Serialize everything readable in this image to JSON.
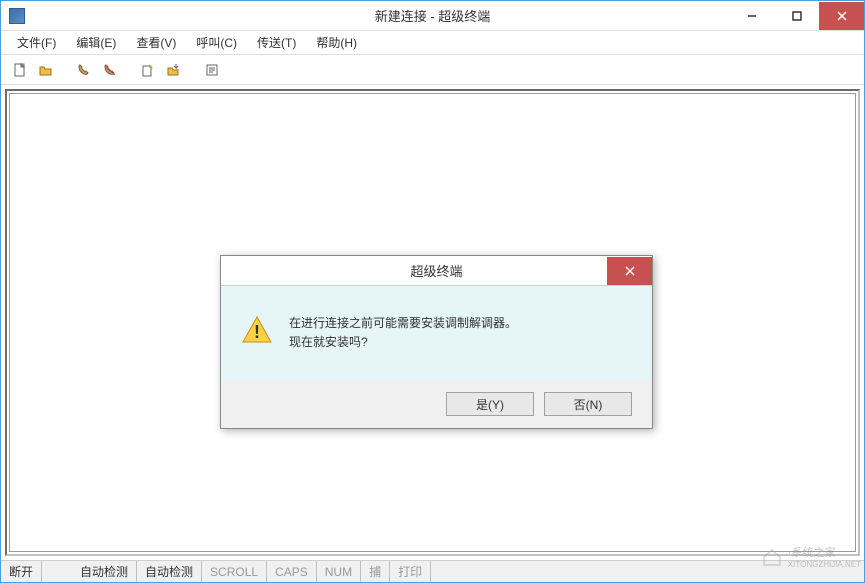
{
  "window": {
    "title": "新建连接 - 超级终端"
  },
  "menubar": {
    "items": [
      "文件(F)",
      "编辑(E)",
      "查看(V)",
      "呼叫(C)",
      "传送(T)",
      "帮助(H)"
    ]
  },
  "toolbar": {
    "icons": [
      "new-doc-icon",
      "open-icon",
      "phone-icon",
      "phone-hangup-icon",
      "send-icon",
      "receive-icon",
      "properties-icon"
    ]
  },
  "statusbar": {
    "items": [
      {
        "text": "断开",
        "dim": false
      },
      {
        "text": "自动检测",
        "dim": false
      },
      {
        "text": "自动检测",
        "dim": false
      },
      {
        "text": "SCROLL",
        "dim": true
      },
      {
        "text": "CAPS",
        "dim": true
      },
      {
        "text": "NUM",
        "dim": true
      },
      {
        "text": "捕",
        "dim": true
      },
      {
        "text": "打印",
        "dim": true
      }
    ]
  },
  "dialog": {
    "title": "超级终端",
    "message_line1": "在进行连接之前可能需要安装调制解调器。",
    "message_line2": "现在就安装吗?",
    "yes_label": "是(Y)",
    "no_label": "否(N)"
  },
  "watermark": {
    "text": "·系统之家",
    "url": "XITONGZHIJIA.NET"
  }
}
